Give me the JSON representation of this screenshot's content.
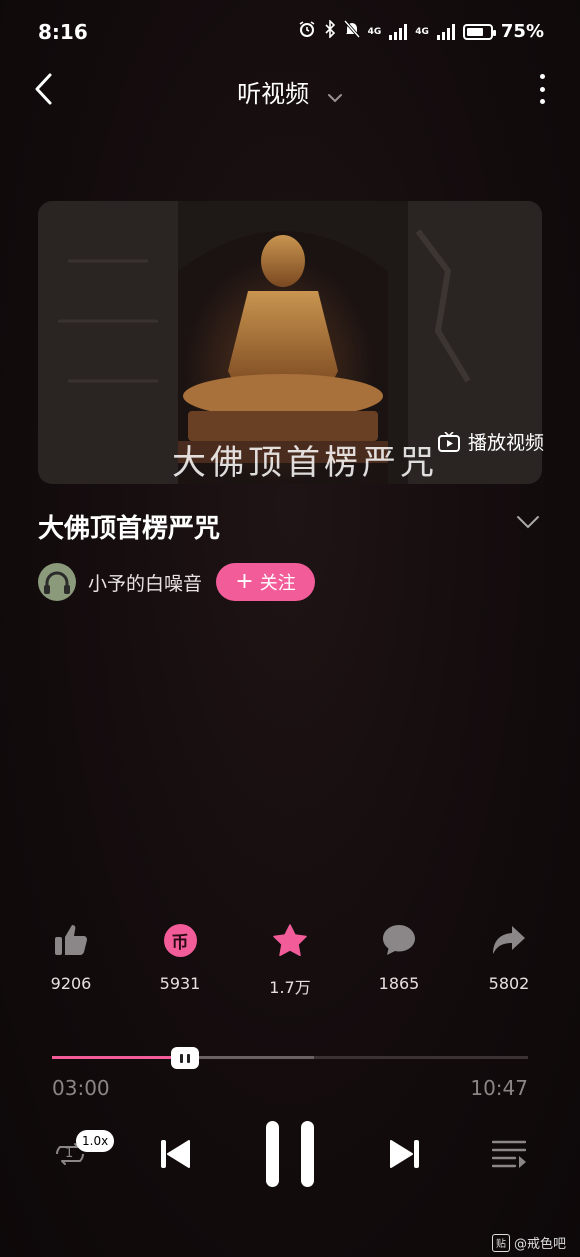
{
  "status_bar": {
    "time": "8:16",
    "network1": "4G",
    "network2": "4G",
    "battery": "75%",
    "battery_level": 0.75
  },
  "header": {
    "title": "听视频"
  },
  "video": {
    "overlay_text": "大佛顶首楞严咒",
    "play_label": "播放视频"
  },
  "track": {
    "title": "大佛顶首楞严咒",
    "author": "小予的白噪音",
    "follow_label": "关注"
  },
  "actions": [
    {
      "icon": "thumbs-up-icon",
      "count": "9206"
    },
    {
      "icon": "coin-icon",
      "count": "5931",
      "coin_glyph": "币"
    },
    {
      "icon": "star-icon",
      "count": "1.7万"
    },
    {
      "icon": "comment-icon",
      "count": "1865"
    },
    {
      "icon": "share-icon",
      "count": "5802"
    }
  ],
  "player": {
    "current_time": "03:00",
    "total_time": "10:47",
    "speed": "1.0x",
    "loop_count": "1",
    "progress": 0.28,
    "buffered": 0.55
  },
  "watermark": {
    "badge": "贴",
    "text": "@戒色吧"
  },
  "colors": {
    "accent": "#f25c98",
    "background": "#150d0e"
  }
}
